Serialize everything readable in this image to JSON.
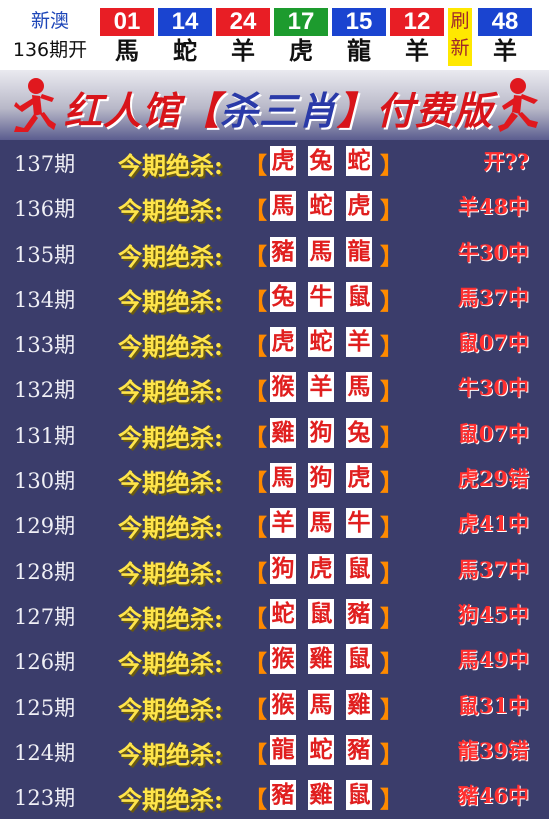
{
  "header": {
    "region": "新澳",
    "draw": "136期开",
    "balls": [
      {
        "num": "01",
        "zodiac": "馬",
        "color": "#e81e25"
      },
      {
        "num": "14",
        "zodiac": "蛇",
        "color": "#1a44d0"
      },
      {
        "num": "24",
        "zodiac": "羊",
        "color": "#e81e25"
      },
      {
        "num": "17",
        "zodiac": "虎",
        "color": "#1d9b2e"
      },
      {
        "num": "15",
        "zodiac": "龍",
        "color": "#1a44d0"
      },
      {
        "num": "12",
        "zodiac": "羊",
        "color": "#e81e25"
      }
    ],
    "refresh": [
      "刷",
      "新"
    ],
    "special": {
      "num": "48",
      "zodiac": "羊",
      "color": "#1a44d0"
    }
  },
  "banner": {
    "title_a": "红人馆【",
    "title_b": "杀三肖",
    "title_c": "】付费版"
  },
  "rows": [
    {
      "period": "137期",
      "label": "今期绝杀:",
      "z": [
        "虎",
        "兔",
        "蛇"
      ],
      "result": "开??"
    },
    {
      "period": "136期",
      "label": "今期绝杀:",
      "z": [
        "馬",
        "蛇",
        "虎"
      ],
      "result": "羊48中"
    },
    {
      "period": "135期",
      "label": "今期绝杀:",
      "z": [
        "豬",
        "馬",
        "龍"
      ],
      "result": "牛30中"
    },
    {
      "period": "134期",
      "label": "今期绝杀:",
      "z": [
        "兔",
        "牛",
        "鼠"
      ],
      "result": "馬37中"
    },
    {
      "period": "133期",
      "label": "今期绝杀:",
      "z": [
        "虎",
        "蛇",
        "羊"
      ],
      "result": "鼠07中"
    },
    {
      "period": "132期",
      "label": "今期绝杀:",
      "z": [
        "猴",
        "羊",
        "馬"
      ],
      "result": "牛30中"
    },
    {
      "period": "131期",
      "label": "今期绝杀:",
      "z": [
        "雞",
        "狗",
        "兔"
      ],
      "result": "鼠07中"
    },
    {
      "period": "130期",
      "label": "今期绝杀:",
      "z": [
        "馬",
        "狗",
        "虎"
      ],
      "result": "虎29错"
    },
    {
      "period": "129期",
      "label": "今期绝杀:",
      "z": [
        "羊",
        "馬",
        "牛"
      ],
      "result": "虎41中"
    },
    {
      "period": "128期",
      "label": "今期绝杀:",
      "z": [
        "狗",
        "虎",
        "鼠"
      ],
      "result": "馬37中"
    },
    {
      "period": "127期",
      "label": "今期绝杀:",
      "z": [
        "蛇",
        "鼠",
        "豬"
      ],
      "result": "狗45中"
    },
    {
      "period": "126期",
      "label": "今期绝杀:",
      "z": [
        "猴",
        "雞",
        "鼠"
      ],
      "result": "馬49中"
    },
    {
      "period": "125期",
      "label": "今期绝杀:",
      "z": [
        "猴",
        "馬",
        "雞"
      ],
      "result": "鼠31中"
    },
    {
      "period": "124期",
      "label": "今期绝杀:",
      "z": [
        "龍",
        "蛇",
        "豬"
      ],
      "result": "龍39错"
    },
    {
      "period": "123期",
      "label": "今期绝杀:",
      "z": [
        "豬",
        "雞",
        "鼠"
      ],
      "result": "豬46中"
    }
  ]
}
